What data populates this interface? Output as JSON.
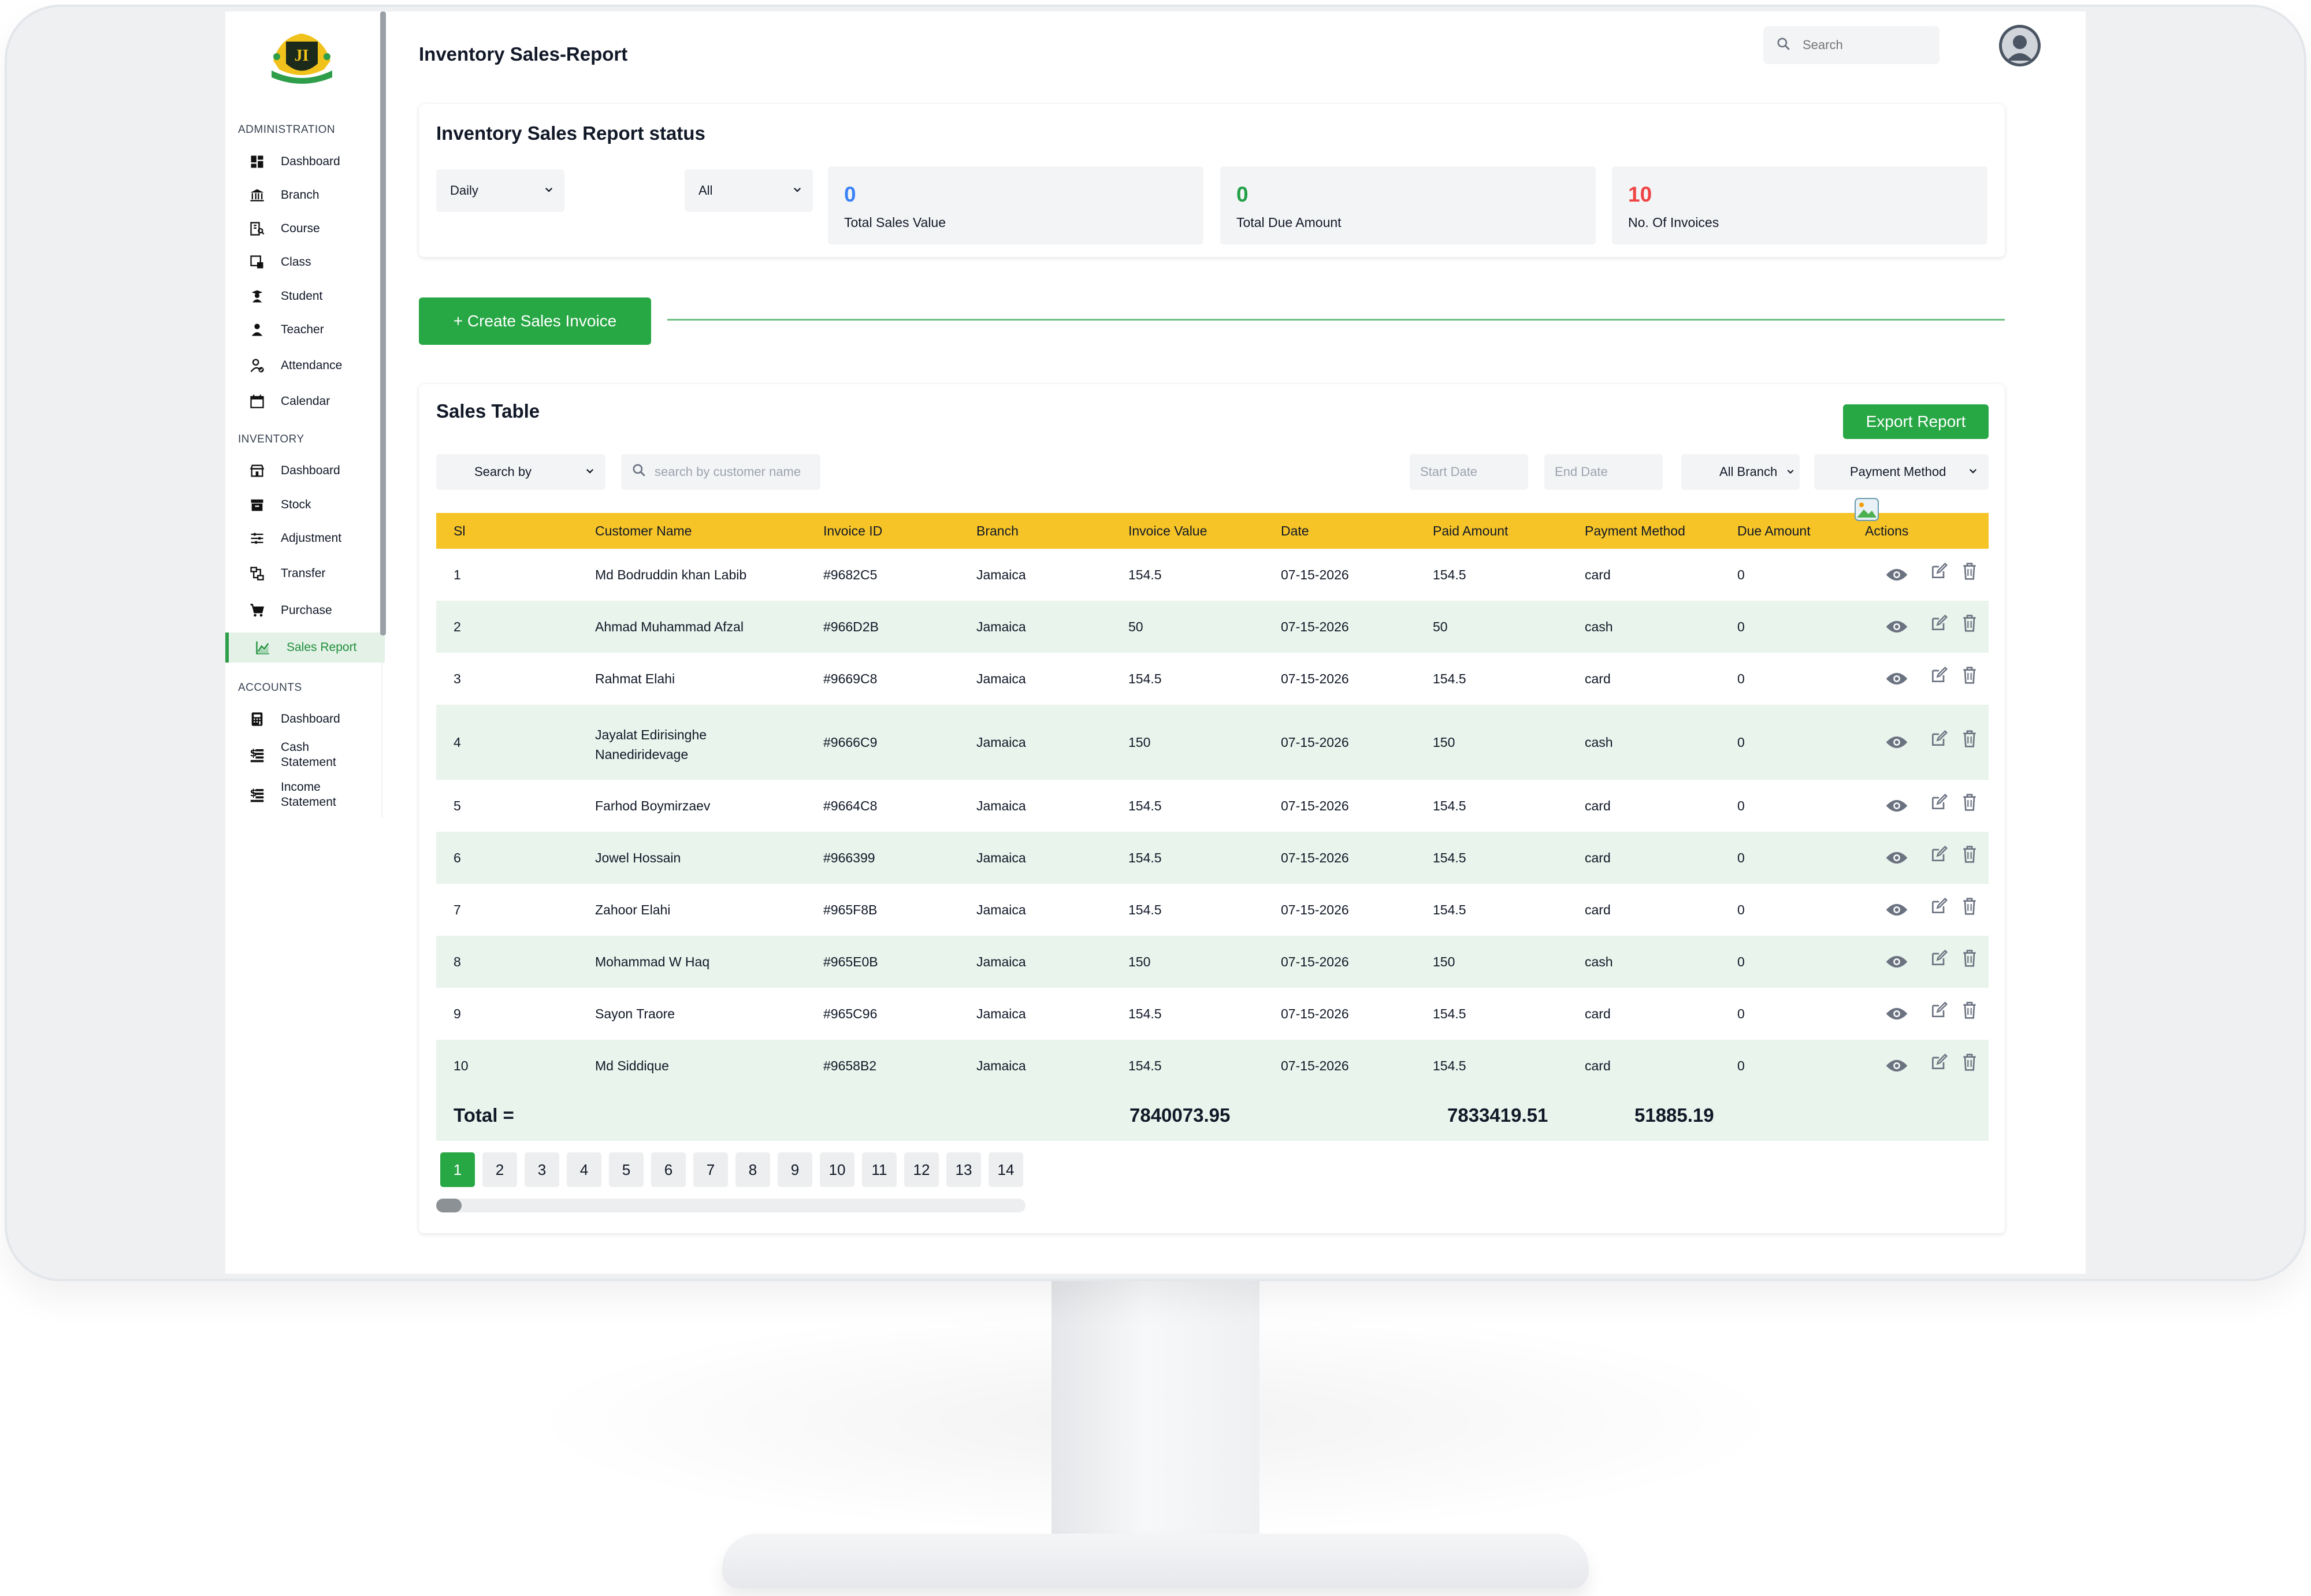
{
  "sidebar": {
    "section_admin": "ADMINISTRATION",
    "section_inventory": "INVENTORY",
    "section_accounts": "ACCOUNTS",
    "admin_items": [
      {
        "label": "Dashboard",
        "icon": "dashboard-icon"
      },
      {
        "label": "Branch",
        "icon": "bank-icon"
      },
      {
        "label": "Course",
        "icon": "book-icon"
      },
      {
        "label": "Class",
        "icon": "class-icon"
      },
      {
        "label": "Student",
        "icon": "student-icon"
      },
      {
        "label": "Teacher",
        "icon": "teacher-icon"
      },
      {
        "label": "Attendance",
        "icon": "attendance-icon"
      },
      {
        "label": "Calendar",
        "icon": "calendar-icon"
      }
    ],
    "inventory_items": [
      {
        "label": "Dashboard",
        "icon": "store-icon"
      },
      {
        "label": "Stock",
        "icon": "archive-icon"
      },
      {
        "label": "Adjustment",
        "icon": "sliders-icon"
      },
      {
        "label": "Transfer",
        "icon": "transfer-icon"
      },
      {
        "label": "Purchase",
        "icon": "cart-icon"
      },
      {
        "label": "Sales Report",
        "icon": "chart-icon",
        "active": true
      }
    ],
    "accounts_items": [
      {
        "label": "Dashboard",
        "icon": "calculator-icon"
      },
      {
        "label": "Cash Statement",
        "line1": "Cash",
        "line2": "Statement",
        "icon": "cash-icon"
      },
      {
        "label": "Income Statement",
        "line1": "Income",
        "line2": "Statement",
        "icon": "income-icon"
      }
    ]
  },
  "header": {
    "title": "Inventory Sales-Report",
    "search_placeholder": "Search"
  },
  "status": {
    "title": "Inventory Sales Report status",
    "period_select": "Daily",
    "branch_select": "All",
    "stats": [
      {
        "value": "0",
        "label": "Total Sales Value",
        "color": "#3b82f6"
      },
      {
        "value": "0",
        "label": "Total Due Amount",
        "color": "#22a046"
      },
      {
        "value": "10",
        "label": "No. Of Invoices",
        "color": "#ef4444"
      }
    ]
  },
  "create_button": "+ Create Sales Invoice",
  "sales_table": {
    "title": "Sales Table",
    "export_label": "Export Report",
    "search_by": "Search by",
    "search_placeholder": "search by customer name",
    "start_date_placeholder": "Start Date",
    "end_date_placeholder": "End Date",
    "branch_filter": "All Branch",
    "payment_filter": "Payment Method",
    "columns": [
      "Sl",
      "Customer Name",
      "Invoice ID",
      "Branch",
      "Invoice Value",
      "Date",
      "Paid Amount",
      "Payment Method",
      "Due Amount",
      "Actions"
    ],
    "rows": [
      {
        "sl": "1",
        "customer": "Md Bodruddin khan Labib",
        "invoice_id": "#9682C5",
        "branch": "Jamaica",
        "value": "154.5",
        "date": "07-15-2026",
        "paid": "154.5",
        "method": "card",
        "due": "0"
      },
      {
        "sl": "2",
        "customer": "Ahmad Muhammad Afzal",
        "invoice_id": "#966D2B",
        "branch": "Jamaica",
        "value": "50",
        "date": "07-15-2026",
        "paid": "50",
        "method": "cash",
        "due": "0"
      },
      {
        "sl": "3",
        "customer": "Rahmat Elahi",
        "invoice_id": "#9669C8",
        "branch": "Jamaica",
        "value": "154.5",
        "date": "07-15-2026",
        "paid": "154.5",
        "method": "card",
        "due": "0"
      },
      {
        "sl": "4",
        "customer": "Jayalat Edirisinghe",
        "customer_line2": "Nanediridevage",
        "invoice_id": "#9666C9",
        "branch": "Jamaica",
        "value": "150",
        "date": "07-15-2026",
        "paid": "150",
        "method": "cash",
        "due": "0"
      },
      {
        "sl": "5",
        "customer": "Farhod Boymirzaev",
        "invoice_id": "#9664C8",
        "branch": "Jamaica",
        "value": "154.5",
        "date": "07-15-2026",
        "paid": "154.5",
        "method": "card",
        "due": "0"
      },
      {
        "sl": "6",
        "customer": "Jowel Hossain",
        "invoice_id": "#966399",
        "branch": "Jamaica",
        "value": "154.5",
        "date": "07-15-2026",
        "paid": "154.5",
        "method": "card",
        "due": "0"
      },
      {
        "sl": "7",
        "customer": "Zahoor Elahi",
        "invoice_id": "#965F8B",
        "branch": "Jamaica",
        "value": "154.5",
        "date": "07-15-2026",
        "paid": "154.5",
        "method": "card",
        "due": "0"
      },
      {
        "sl": "8",
        "customer": "Mohammad W Haq",
        "invoice_id": "#965E0B",
        "branch": "Jamaica",
        "value": "150",
        "date": "07-15-2026",
        "paid": "150",
        "method": "cash",
        "due": "0"
      },
      {
        "sl": "9",
        "customer": "Sayon Traore",
        "invoice_id": "#965C96",
        "branch": "Jamaica",
        "value": "154.5",
        "date": "07-15-2026",
        "paid": "154.5",
        "method": "card",
        "due": "0"
      },
      {
        "sl": "10",
        "customer": "Md Siddique",
        "invoice_id": "#9658B2",
        "branch": "Jamaica",
        "value": "154.5",
        "date": "07-15-2026",
        "paid": "154.5",
        "method": "card",
        "due": "0"
      }
    ],
    "total_label": "Total =",
    "total_invoice_value": "7840073.95",
    "total_paid": "7833419.51",
    "total_due": "51885.19",
    "pages": [
      "1",
      "2",
      "3",
      "4",
      "5",
      "6",
      "7",
      "8",
      "9",
      "10",
      "11",
      "12",
      "13",
      "14"
    ],
    "current_page": "1"
  },
  "colors": {
    "primary_green": "#28a745",
    "table_header": "#f6c427",
    "row_alt": "#e8f4ec"
  }
}
